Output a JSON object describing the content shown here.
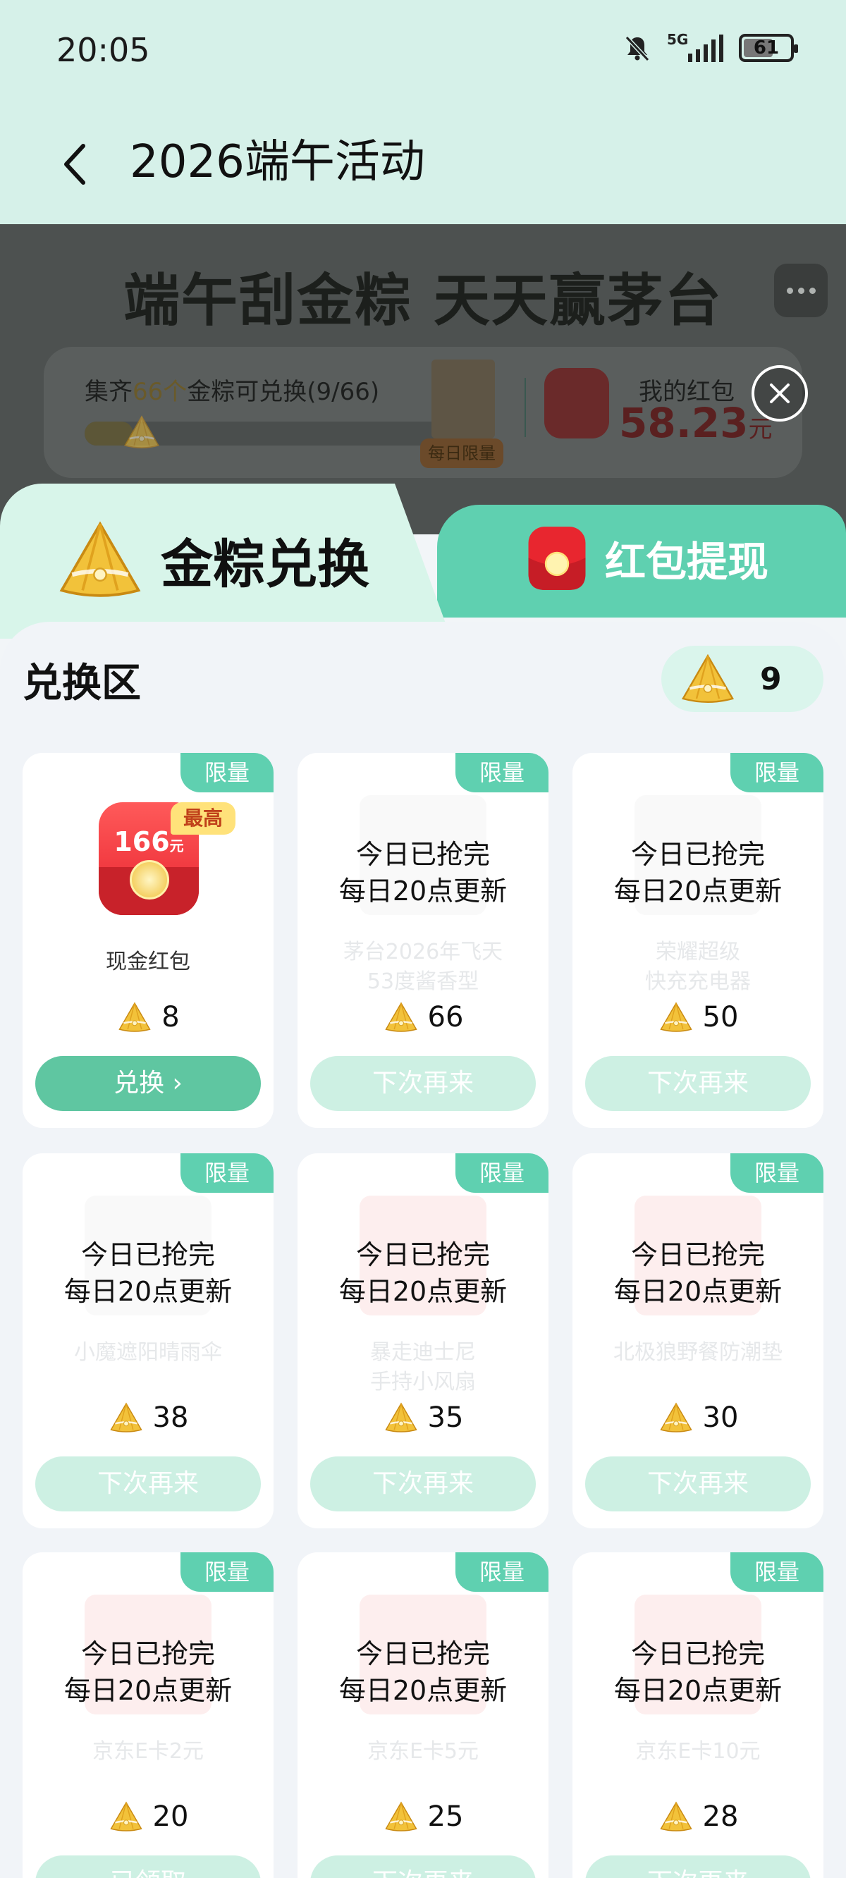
{
  "status_bar": {
    "time": "20:05",
    "network": "5G",
    "battery": "61",
    "icons": [
      "bell-off-icon",
      "signal-icon",
      "battery-icon"
    ]
  },
  "header": {
    "title": "2026端午活动",
    "back_icon": "chevron-left-icon"
  },
  "banner": {
    "title": "端午刮金粽 天天赢茅台",
    "progress_text_prefix": "集齐",
    "progress_highlight": "66个",
    "progress_text_suffix": "金粽可兑换(9/66)",
    "progress_fraction": 0.136,
    "daily_limit_tag": "每日限量",
    "my_redpacket_label": "我的红包",
    "my_redpacket_amount": "58.23",
    "my_redpacket_unit": "元"
  },
  "tabs": [
    {
      "label": "金粽兑换",
      "active": true,
      "icon": "golden-zongzi-icon"
    },
    {
      "label": "红包提现",
      "active": false,
      "icon": "red-packet-icon"
    }
  ],
  "exchange": {
    "section_title": "兑换区",
    "balance": "9"
  },
  "items": [
    {
      "tag": "限量",
      "status_line1": "",
      "status_line2": "",
      "name_line1": "现金红包",
      "name_line2": "",
      "price": "8",
      "button": "兑换 ›",
      "available": true,
      "badge": "最高",
      "packet_value": "166",
      "packet_unit": "元"
    },
    {
      "tag": "限量",
      "status_line1": "今日已抢完",
      "status_line2": "每日20点更新",
      "name_line1": "茅台2026年飞天",
      "name_line2": "53度酱香型",
      "price": "66",
      "button": "下次再来",
      "available": false
    },
    {
      "tag": "限量",
      "status_line1": "今日已抢完",
      "status_line2": "每日20点更新",
      "name_line1": "荣耀超级",
      "name_line2": "快充充电器",
      "price": "50",
      "button": "下次再来",
      "available": false
    },
    {
      "tag": "限量",
      "status_line1": "今日已抢完",
      "status_line2": "每日20点更新",
      "name_line1": "小魔遮阳晴雨伞",
      "name_line2": "",
      "price": "38",
      "button": "下次再来",
      "available": false
    },
    {
      "tag": "限量",
      "status_line1": "今日已抢完",
      "status_line2": "每日20点更新",
      "name_line1": "暴走迪士尼",
      "name_line2": "手持小风扇",
      "price": "35",
      "button": "下次再来",
      "available": false
    },
    {
      "tag": "限量",
      "status_line1": "今日已抢完",
      "status_line2": "每日20点更新",
      "name_line1": "北极狼野餐防潮垫",
      "name_line2": "",
      "price": "30",
      "button": "下次再来",
      "available": false
    },
    {
      "tag": "限量",
      "status_line1": "今日已抢完",
      "status_line2": "每日20点更新",
      "name_line1": "京东E卡2元",
      "name_line2": "",
      "price": "20",
      "button": "已领取",
      "available": false
    },
    {
      "tag": "限量",
      "status_line1": "今日已抢完",
      "status_line2": "每日20点更新",
      "name_line1": "京东E卡5元",
      "name_line2": "",
      "price": "25",
      "button": "下次再来",
      "available": false
    },
    {
      "tag": "限量",
      "status_line1": "今日已抢完",
      "status_line2": "每日20点更新",
      "name_line1": "京东E卡10元",
      "name_line2": "",
      "price": "28",
      "button": "下次再来",
      "available": false
    }
  ],
  "colors": {
    "accent": "#5fd0b0",
    "header_bg": "#d6f1e9",
    "button_active": "#5fc6a1",
    "button_disabled": "#cdf0e3",
    "red_amount": "#d42a2a"
  }
}
